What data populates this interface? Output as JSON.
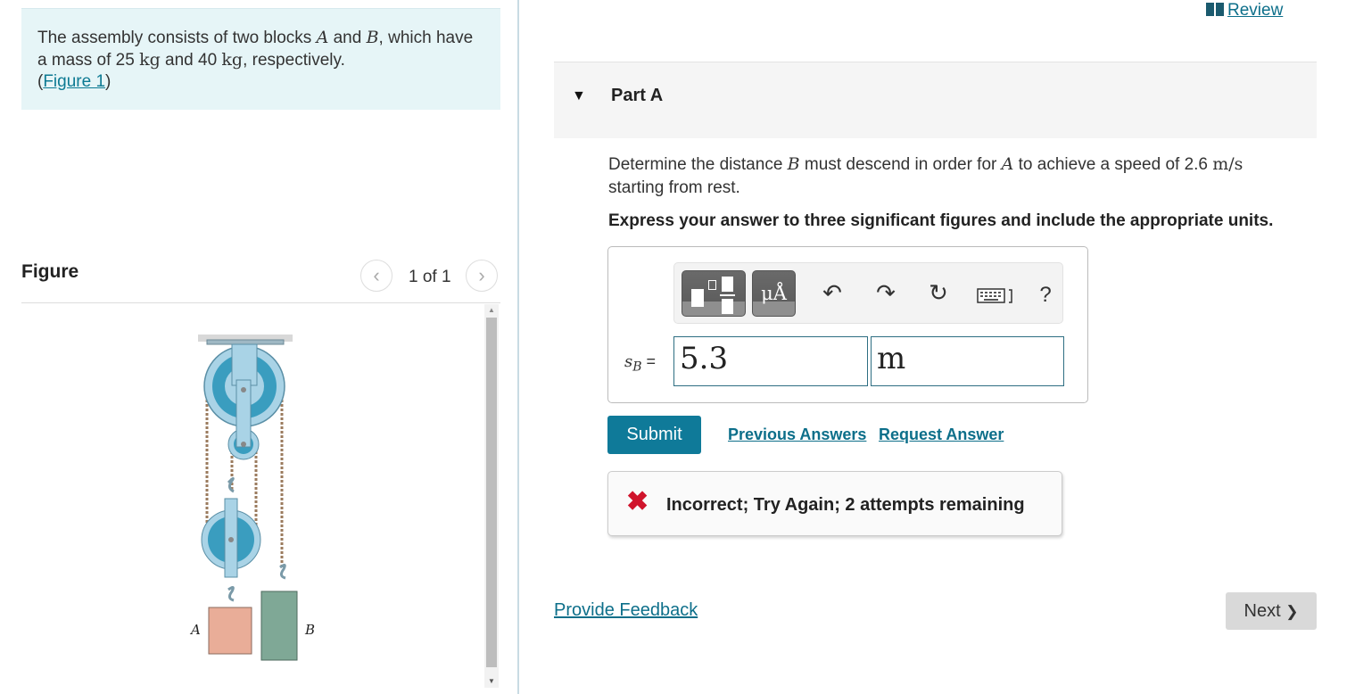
{
  "intro": {
    "text_1": "The assembly consists of two blocks ",
    "var_a": "A",
    "text_2": " and ",
    "var_b": "B",
    "text_3": ", which have a mass of 25 ",
    "unit_1": "kg",
    "text_4": " and 40 ",
    "unit_2": "kg",
    "text_5": ", respectively.",
    "paren_open": "(",
    "figure_link": "Figure 1",
    "paren_close": ")"
  },
  "figure": {
    "title": "Figure",
    "count": "1 of 1",
    "prev_icon": "‹",
    "next_icon": "›",
    "label_a": "A",
    "label_b": "B",
    "colors": {
      "pulley": "#3a9dbf",
      "pulley_light": "#a9d3e6",
      "block_a": "#e9ad98",
      "block_b": "#7fa896",
      "rope": "#9b7b5e"
    }
  },
  "review": {
    "label": "Review"
  },
  "part_a": {
    "title": "Part A",
    "question_1": "Determine the distance ",
    "question_var_b": "B",
    "question_2": " must descend in order for ",
    "question_var_a": "A",
    "question_3": " to achieve a speed of 2.6 ",
    "question_unit": "m/s",
    "question_4": " starting from rest.",
    "instruction": "Express your answer to three significant figures and include the appropriate units."
  },
  "toolbar": {
    "units_label": "μÅ",
    "undo_icon": "↶",
    "redo_icon": "↷",
    "reset_icon": "↻",
    "help_label": "?"
  },
  "answer": {
    "label_var": "s",
    "label_sub": "B",
    "label_eq": " =",
    "value": "5.3",
    "unit": "m"
  },
  "actions": {
    "submit": "Submit",
    "previous_answers": "Previous Answers",
    "request_answer": "Request Answer"
  },
  "feedback": {
    "icon": "✖",
    "message": "Incorrect; Try Again; 2 attempts remaining",
    "icon_color": "#d0142c"
  },
  "footer": {
    "provide_feedback": "Provide Feedback",
    "next": "Next",
    "next_icon": "❯"
  },
  "colors": {
    "accent": "#0f7a99",
    "link": "#0d6f8a",
    "intro_bg": "#e6f5f7"
  }
}
